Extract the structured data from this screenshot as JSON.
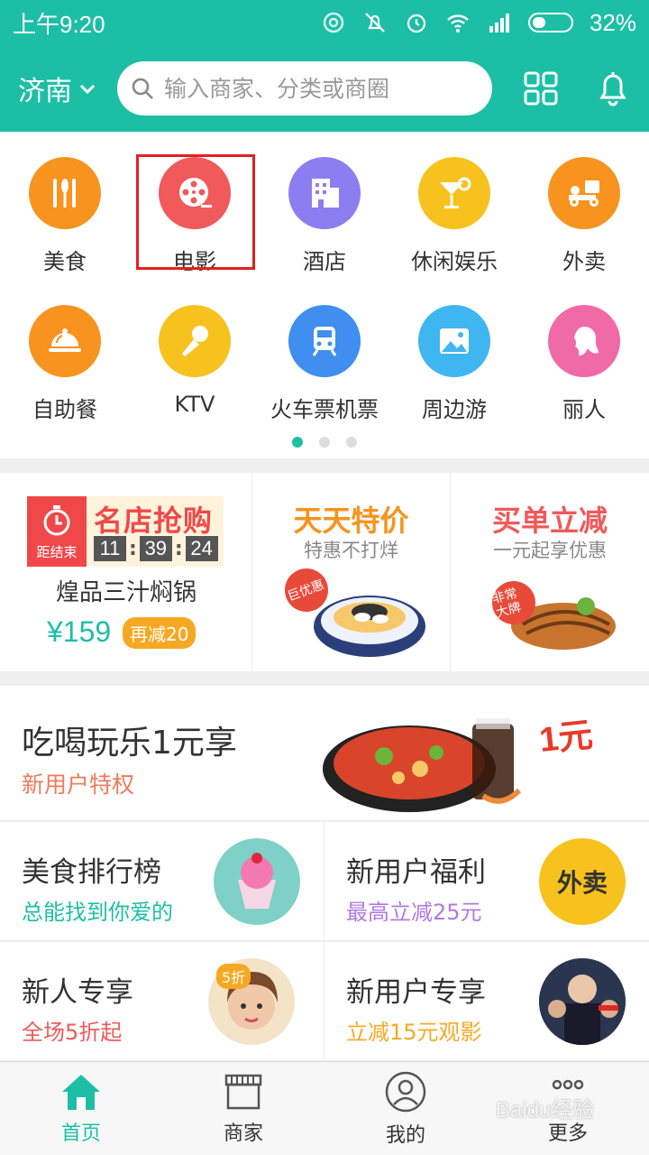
{
  "status_bar": {
    "time": "上午9:20",
    "battery": "32%"
  },
  "header": {
    "city": "济南",
    "search_placeholder": "输入商家、分类或商圈"
  },
  "categories": [
    {
      "label": "美食",
      "color": "#f7931e",
      "icon": "fork-knife-icon"
    },
    {
      "label": "电影",
      "color": "#f05a5a",
      "icon": "film-reel-icon"
    },
    {
      "label": "酒店",
      "color": "#8c7ef0",
      "icon": "building-icon"
    },
    {
      "label": "休闲娱乐",
      "color": "#f7c21e",
      "icon": "cocktail-icon"
    },
    {
      "label": "外卖",
      "color": "#f7931e",
      "icon": "delivery-scooter-icon"
    },
    {
      "label": "自助餐",
      "color": "#f7931e",
      "icon": "cloche-icon"
    },
    {
      "label": "KTV",
      "color": "#f7c21e",
      "icon": "microphone-icon"
    },
    {
      "label": "火车票机票",
      "color": "#3f8ef0",
      "icon": "train-icon"
    },
    {
      "label": "周边游",
      "color": "#3fb6f0",
      "icon": "landscape-icon"
    },
    {
      "label": "丽人",
      "color": "#f06aa8",
      "icon": "woman-profile-icon"
    }
  ],
  "promo": {
    "flash": {
      "tag": "距结束",
      "title": "名店抢购",
      "countdown": [
        "11",
        "39",
        "24"
      ],
      "name": "煌品三汁焖锅",
      "price": "¥159",
      "reduce": "再减20"
    },
    "daily": {
      "title": "天天特价",
      "sub": "特惠不打烊",
      "badge": "巨优惠"
    },
    "discount": {
      "title": "买单立减",
      "sub": "一元起享优惠",
      "badge": "非常大牌"
    }
  },
  "banner": {
    "title": "吃喝玩乐1元享",
    "sub": "新用户特权",
    "badge": "1元"
  },
  "features": [
    {
      "title": "美食排行榜",
      "sub": "总能找到你爱的",
      "sub_color": "#1cbfa6"
    },
    {
      "title": "新用户福利",
      "sub": "最高立减25元",
      "sub_color": "#b07ae0",
      "badge": "外卖"
    },
    {
      "title": "新人专享",
      "sub": "全场5折起",
      "sub_color": "#f05a5a",
      "badge": "5折"
    },
    {
      "title": "新用户专享",
      "sub": "立减15元观影",
      "sub_color": "#f7a823"
    }
  ],
  "tabs": [
    {
      "label": "首页",
      "active": true
    },
    {
      "label": "商家"
    },
    {
      "label": "我的"
    },
    {
      "label": "更多"
    }
  ],
  "watermark": "Baidu经验"
}
